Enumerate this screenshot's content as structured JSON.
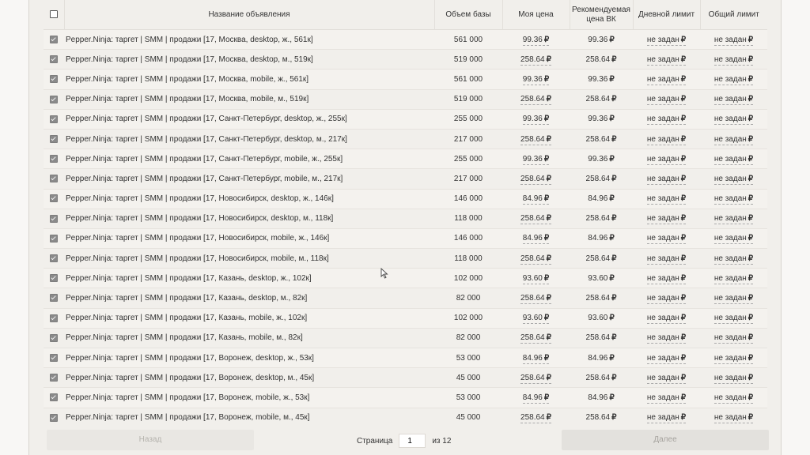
{
  "table": {
    "headers": {
      "name": "Название объявления",
      "volume": "Объем базы",
      "my_price": "Моя цена",
      "recommended": "Рекомендуемая цена ВК",
      "daily_limit": "Дневной лимит",
      "total_limit": "Общий лимит"
    },
    "currency_symbol": "₽",
    "rows": [
      {
        "name": "Pepper.Ninja: таргет | SMM | продажи [17, Москва, desktop, ж., 561к]",
        "volume": "561 000",
        "my_price": "99.36",
        "recommended": "99.36",
        "daily_limit": "не задан",
        "total_limit": "не задан"
      },
      {
        "name": "Pepper.Ninja: таргет | SMM | продажи [17, Москва, desktop, м., 519к]",
        "volume": "519 000",
        "my_price": "258.64",
        "recommended": "258.64",
        "daily_limit": "не задан",
        "total_limit": "не задан"
      },
      {
        "name": "Pepper.Ninja: таргет | SMM | продажи [17, Москва, mobile, ж., 561к]",
        "volume": "561 000",
        "my_price": "99.36",
        "recommended": "99.36",
        "daily_limit": "не задан",
        "total_limit": "не задан"
      },
      {
        "name": "Pepper.Ninja: таргет | SMM | продажи [17, Москва, mobile, м., 519к]",
        "volume": "519 000",
        "my_price": "258.64",
        "recommended": "258.64",
        "daily_limit": "не задан",
        "total_limit": "не задан"
      },
      {
        "name": "Pepper.Ninja: таргет | SMM | продажи [17, Санкт-Петербург, desktop, ж., 255к]",
        "volume": "255 000",
        "my_price": "99.36",
        "recommended": "99.36",
        "daily_limit": "не задан",
        "total_limit": "не задан"
      },
      {
        "name": "Pepper.Ninja: таргет | SMM | продажи [17, Санкт-Петербург, desktop, м., 217к]",
        "volume": "217 000",
        "my_price": "258.64",
        "recommended": "258.64",
        "daily_limit": "не задан",
        "total_limit": "не задан"
      },
      {
        "name": "Pepper.Ninja: таргет | SMM | продажи [17, Санкт-Петербург, mobile, ж., 255к]",
        "volume": "255 000",
        "my_price": "99.36",
        "recommended": "99.36",
        "daily_limit": "не задан",
        "total_limit": "не задан"
      },
      {
        "name": "Pepper.Ninja: таргет | SMM | продажи [17, Санкт-Петербург, mobile, м., 217к]",
        "volume": "217 000",
        "my_price": "258.64",
        "recommended": "258.64",
        "daily_limit": "не задан",
        "total_limit": "не задан"
      },
      {
        "name": "Pepper.Ninja: таргет | SMM | продажи [17, Новосибирск, desktop, ж., 146к]",
        "volume": "146 000",
        "my_price": "84.96",
        "recommended": "84.96",
        "daily_limit": "не задан",
        "total_limit": "не задан"
      },
      {
        "name": "Pepper.Ninja: таргет | SMM | продажи [17, Новосибирск, desktop, м., 118к]",
        "volume": "118 000",
        "my_price": "258.64",
        "recommended": "258.64",
        "daily_limit": "не задан",
        "total_limit": "не задан"
      },
      {
        "name": "Pepper.Ninja: таргет | SMM | продажи [17, Новосибирск, mobile, ж., 146к]",
        "volume": "146 000",
        "my_price": "84.96",
        "recommended": "84.96",
        "daily_limit": "не задан",
        "total_limit": "не задан"
      },
      {
        "name": "Pepper.Ninja: таргет | SMM | продажи [17, Новосибирск, mobile, м., 118к]",
        "volume": "118 000",
        "my_price": "258.64",
        "recommended": "258.64",
        "daily_limit": "не задан",
        "total_limit": "не задан"
      },
      {
        "name": "Pepper.Ninja: таргет | SMM | продажи [17, Казань, desktop, ж., 102к]",
        "volume": "102 000",
        "my_price": "93.60",
        "recommended": "93.60",
        "daily_limit": "не задан",
        "total_limit": "не задан"
      },
      {
        "name": "Pepper.Ninja: таргет | SMM | продажи [17, Казань, desktop, м., 82к]",
        "volume": "82 000",
        "my_price": "258.64",
        "recommended": "258.64",
        "daily_limit": "не задан",
        "total_limit": "не задан"
      },
      {
        "name": "Pepper.Ninja: таргет | SMM | продажи [17, Казань, mobile, ж., 102к]",
        "volume": "102 000",
        "my_price": "93.60",
        "recommended": "93.60",
        "daily_limit": "не задан",
        "total_limit": "не задан"
      },
      {
        "name": "Pepper.Ninja: таргет | SMM | продажи [17, Казань, mobile, м., 82к]",
        "volume": "82 000",
        "my_price": "258.64",
        "recommended": "258.64",
        "daily_limit": "не задан",
        "total_limit": "не задан"
      },
      {
        "name": "Pepper.Ninja: таргет | SMM | продажи [17, Воронеж, desktop, ж., 53к]",
        "volume": "53 000",
        "my_price": "84.96",
        "recommended": "84.96",
        "daily_limit": "не задан",
        "total_limit": "не задан"
      },
      {
        "name": "Pepper.Ninja: таргет | SMM | продажи [17, Воронеж, desktop, м., 45к]",
        "volume": "45 000",
        "my_price": "258.64",
        "recommended": "258.64",
        "daily_limit": "не задан",
        "total_limit": "не задан"
      },
      {
        "name": "Pepper.Ninja: таргет | SMM | продажи [17, Воронеж, mobile, ж., 53к]",
        "volume": "53 000",
        "my_price": "84.96",
        "recommended": "84.96",
        "daily_limit": "не задан",
        "total_limit": "не задан"
      },
      {
        "name": "Pepper.Ninja: таргет | SMM | продажи [17, Воронеж, mobile, м., 45к]",
        "volume": "45 000",
        "my_price": "258.64",
        "recommended": "258.64",
        "daily_limit": "не задан",
        "total_limit": "не задан"
      }
    ]
  },
  "pagination": {
    "prev_label": "Назад",
    "page_label": "Страница",
    "current_page": "1",
    "of_label": "из 12",
    "next_label": "Далее"
  }
}
